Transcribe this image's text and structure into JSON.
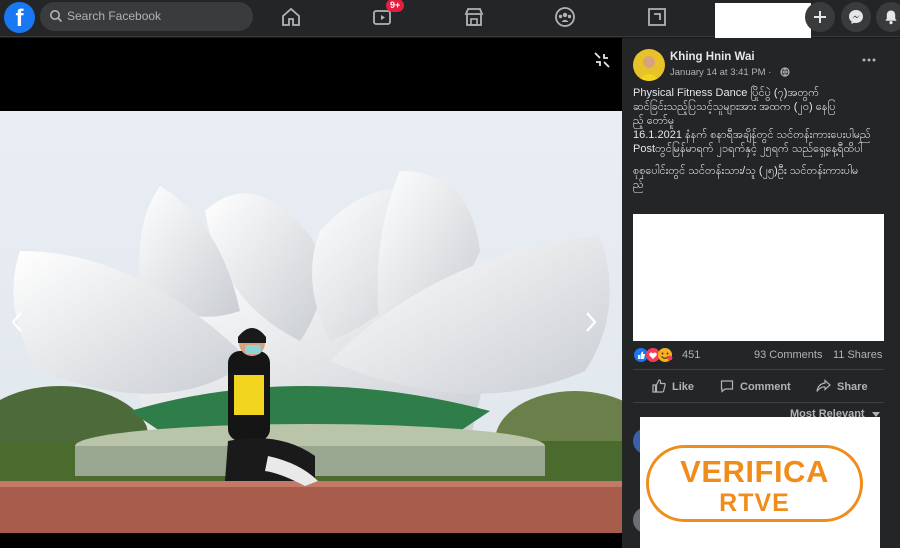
{
  "topbar": {
    "logo": "f",
    "search_placeholder": "Search Facebook",
    "watch_badge": "9+",
    "icons": [
      "home-icon",
      "watch-icon",
      "marketplace-icon",
      "groups-icon",
      "gaming-icon",
      "plus-icon",
      "messenger-icon",
      "notifications-icon"
    ]
  },
  "post": {
    "author": "Khing Hnin Wai",
    "date": "January 14 at 3:41 PM ·",
    "text_lines": [
      "Physical Fitness Dance ပြိုင်ပွဲ (၇)အတွက်",
      "ဆင်ခြင်းသည့်ပြသင့်သူများအား အထက (၂၀) နေပြ",
      "ည့် တော်မူ",
      "16.1.2021 နံနက် စနာရီအချိန်တွင် သင်တန်းကားပေးပါမည်",
      "Postတွင်မြန်မာရက် ၂၁ရက်နှင့် ၂၅ရက် သည်ရှေ့နေ့ရီထိပါ",
      "စုစုပေါင်းတွင် သင်တန်းသား/သူ (၂၅)ဦး သင်တန်းကားပါမ",
      "ည်"
    ],
    "reaction_count": "451",
    "comments": "93 Comments",
    "shares": "11 Shares",
    "actions": {
      "like": "Like",
      "comment": "Comment",
      "share": "Share"
    },
    "sort_label": "Most Relevant"
  },
  "watermark": {
    "line1": "VERIFICA",
    "line2": "RTVE"
  },
  "colors": {
    "accent": "#1877f2",
    "watermark": "#f08c1a",
    "panel": "#242526"
  }
}
